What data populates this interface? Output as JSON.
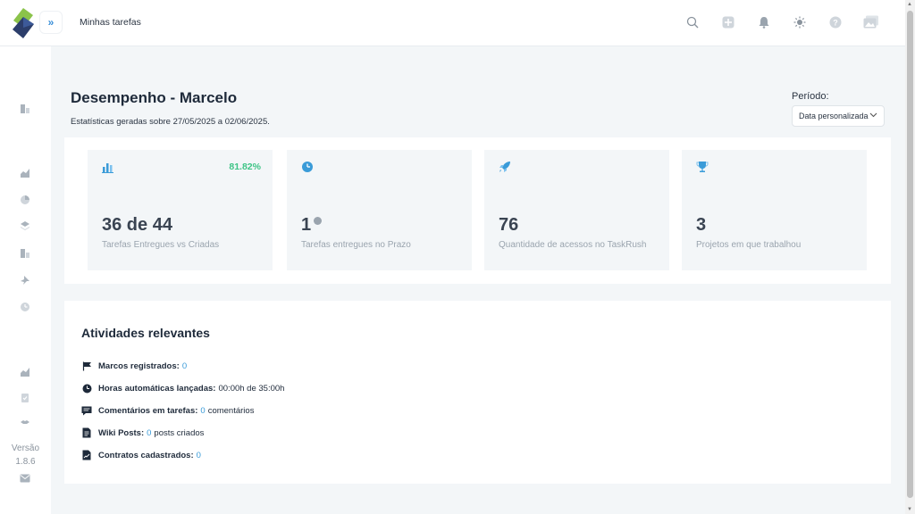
{
  "header": {
    "title": "Minhas tarefas",
    "icons": [
      "search-icon",
      "plus-icon",
      "bell-icon",
      "sun-icon",
      "help-icon",
      "image-icon"
    ]
  },
  "sidebar": {
    "version_label": "Versão",
    "version_number": "1.8.6"
  },
  "page": {
    "title": "Desempenho - Marcelo",
    "subtitle": "Estatísticas geradas sobre 27/05/2025 a 02/06/2025."
  },
  "period": {
    "label": "Período:",
    "selected": "Data personalizada"
  },
  "stats": [
    {
      "icon": "bar-chart-icon",
      "value": "36 de 44",
      "label": "Tarefas Entregues vs Criadas",
      "percent": "81.82%"
    },
    {
      "icon": "clock-icon",
      "value": "1",
      "label": "Tarefas entregues no Prazo"
    },
    {
      "icon": "rocket-icon",
      "value": "76",
      "label": "Quantidade de acessos no TaskRush"
    },
    {
      "icon": "trophy-icon",
      "value": "3",
      "label": "Projetos em que trabalhou"
    }
  ],
  "activities": {
    "title": "Atividades relevantes",
    "items": [
      {
        "icon": "flag-icon",
        "label": "Marcos registrados:",
        "value": "0",
        "suffix": ""
      },
      {
        "icon": "clock-icon",
        "label": "Horas automáticas lançadas:",
        "value": "00:00h de 35:00h",
        "suffix": ""
      },
      {
        "icon": "comment-icon",
        "label": "Comentários em tarefas:",
        "value": "0",
        "suffix": "comentários"
      },
      {
        "icon": "document-icon",
        "label": "Wiki Posts:",
        "value": "0",
        "suffix": "posts criados"
      },
      {
        "icon": "contract-icon",
        "label": "Contratos cadastrados:",
        "value": "0",
        "suffix": ""
      }
    ]
  },
  "colors": {
    "accent_blue": "#3a9bd8",
    "success_green": "#3ec486",
    "logo_green": "#8bc34a",
    "logo_navy": "#2c3e6b"
  }
}
